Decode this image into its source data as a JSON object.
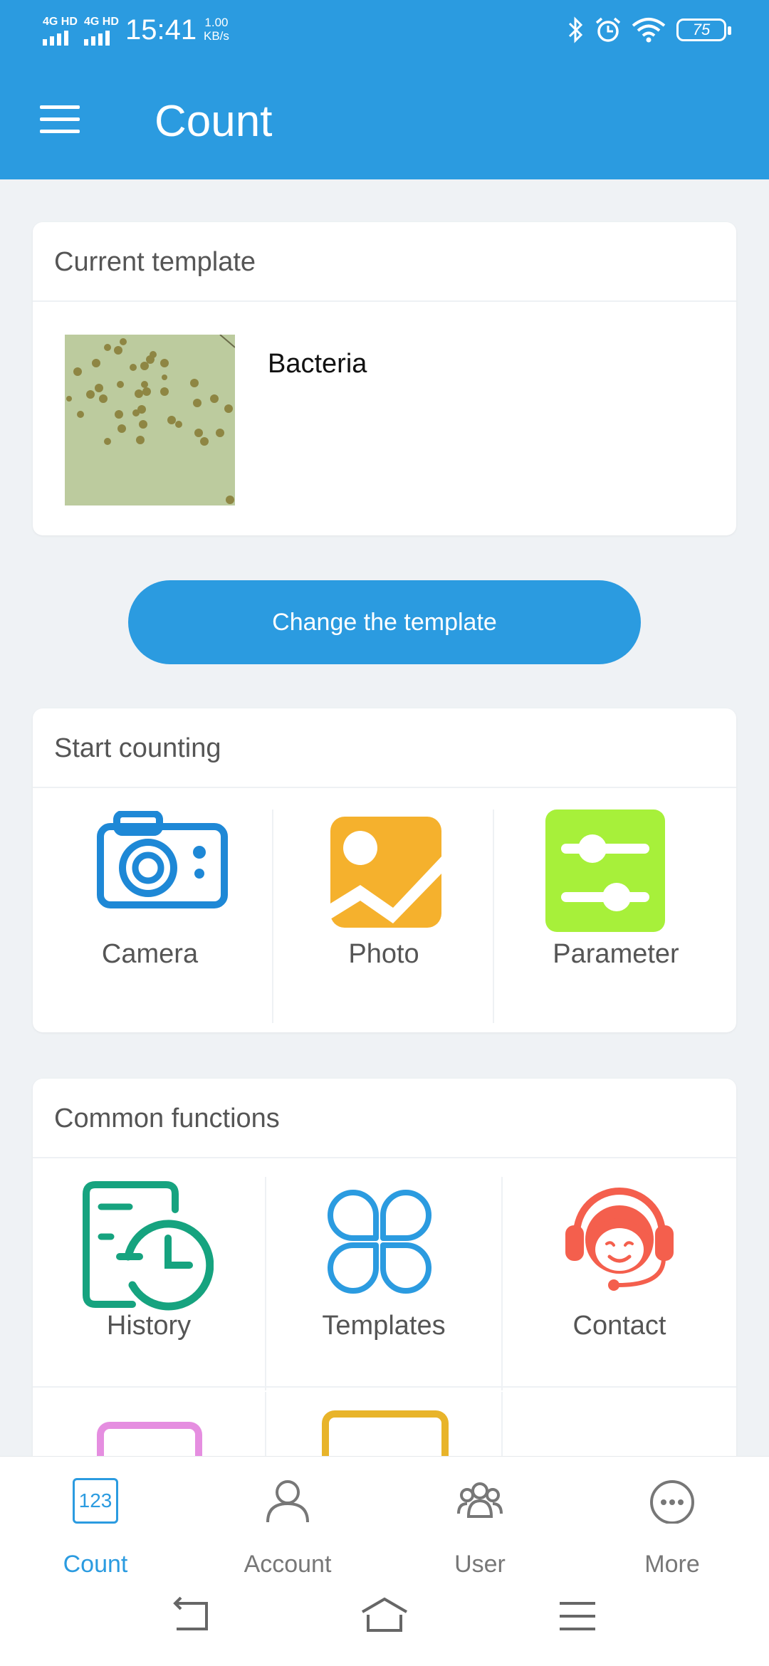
{
  "status_bar": {
    "network1": "4G HD",
    "network2": "4G HD",
    "time": "15:41",
    "speed_value": "1.00",
    "speed_unit": "KB/s",
    "battery": "75"
  },
  "app_bar": {
    "title": "Count"
  },
  "current_template": {
    "heading": "Current template",
    "name": "Bacteria"
  },
  "change_template_button": "Change the template",
  "start_counting": {
    "heading": "Start counting",
    "items": [
      {
        "label": "Camera",
        "icon": "camera-icon",
        "color": "#1e88d6"
      },
      {
        "label": "Photo",
        "icon": "photo-icon",
        "color": "#f5b12d"
      },
      {
        "label": "Parameter",
        "icon": "sliders-icon",
        "color": "#a7f03a"
      }
    ]
  },
  "common_functions": {
    "heading": "Common functions",
    "items": [
      {
        "label": "History",
        "icon": "history-icon",
        "color": "#16a37f"
      },
      {
        "label": "Templates",
        "icon": "templates-icon",
        "color": "#2b9be0"
      },
      {
        "label": "Contact",
        "icon": "support-agent-icon",
        "color": "#f45f4d"
      }
    ]
  },
  "bottom_nav": {
    "tabs": [
      {
        "label": "Count",
        "icon": "count-123-icon",
        "active": true
      },
      {
        "label": "Account",
        "icon": "person-icon",
        "active": false
      },
      {
        "label": "User",
        "icon": "group-icon",
        "active": false
      },
      {
        "label": "More",
        "icon": "more-dots-icon",
        "active": false
      }
    ],
    "count_icon_text": "123"
  },
  "colors": {
    "primary": "#2b9be0",
    "background": "#eff2f5"
  }
}
